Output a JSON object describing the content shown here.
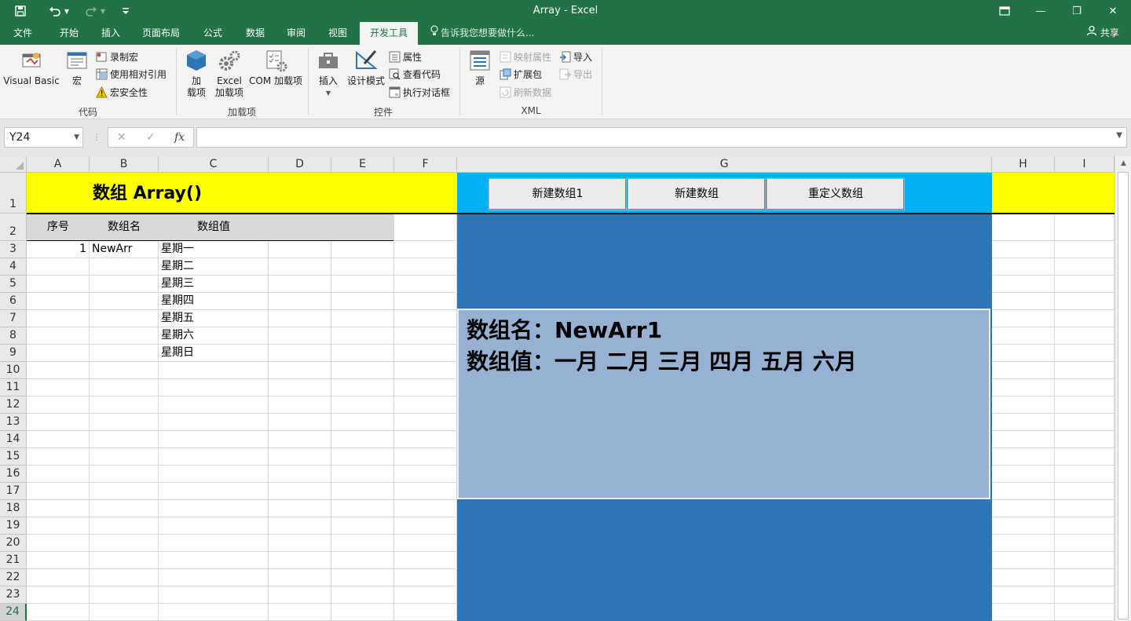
{
  "window": {
    "title": "Array - Excel",
    "save_icon": "save-icon",
    "undo_icon": "undo-icon",
    "redo_icon": "redo-icon",
    "customize_icon": "customize-quick-access-icon",
    "restore_ribbon_icon": "ribbon-display-options-icon",
    "minimize": "—",
    "maximize": "❐",
    "close": "✕"
  },
  "ribbon_tabs": [
    "文件",
    "开始",
    "插入",
    "页面布局",
    "公式",
    "数据",
    "审阅",
    "视图",
    "开发工具"
  ],
  "active_tab": "开发工具",
  "tell_me": "告诉我您想要做什么...",
  "share": "共享",
  "ribbon": {
    "code_group": {
      "label": "代码",
      "visual_basic": "Visual Basic",
      "macros": "宏",
      "record_macro": "录制宏",
      "relative_ref": "使用相对引用",
      "macro_security": "宏安全性"
    },
    "addins_group": {
      "label": "加载项",
      "addins_l1": "加",
      "addins_l2": "载项",
      "excel_addins_l1": "Excel",
      "excel_addins_l2": "加载项",
      "com_addins": "COM 加载项"
    },
    "controls_group": {
      "label": "控件",
      "insert": "插入",
      "design_mode": "设计模式",
      "properties": "属性",
      "view_code": "查看代码",
      "run_dialog": "执行对话框"
    },
    "xml_group": {
      "label": "XML",
      "source": "源",
      "map_properties": "映射属性",
      "expansion_packs": "扩展包",
      "refresh_data": "刷新数据",
      "import": "导入",
      "export": "导出"
    }
  },
  "formula_bar": {
    "name_box": "Y24",
    "cancel": "✕",
    "enter": "✓",
    "fx": "fx",
    "formula": ""
  },
  "columns": [
    "A",
    "B",
    "C",
    "D",
    "E",
    "F",
    "G",
    "H",
    "I"
  ],
  "rows": [
    "1",
    "2",
    "3",
    "4",
    "5",
    "6",
    "7",
    "8",
    "9",
    "10",
    "11",
    "12",
    "13",
    "14",
    "15",
    "16",
    "17",
    "18",
    "19",
    "20",
    "21",
    "22",
    "23",
    "24"
  ],
  "selected_row": "24",
  "sheet": {
    "title": "数组 Array()",
    "headers": {
      "index": "序号",
      "name": "数组名",
      "value": "数组值"
    },
    "index_value": "1",
    "array_name": "NewArr",
    "array_values": [
      "星期一",
      "星期二",
      "星期三",
      "星期四",
      "星期五",
      "星期六",
      "星期日"
    ]
  },
  "buttons": {
    "new_array1": "新建数组1",
    "new_array": "新建数组",
    "redefine_array": "重定义数组"
  },
  "output_box": {
    "line1": "数组名：NewArr1",
    "line2": "数组值：一月 二月 三月 四月 五月 六月"
  },
  "colors": {
    "excel_green": "#217346",
    "title_fill": "#ffff00",
    "button_bar": "#00b0f0",
    "panel_blue": "#2e75b6",
    "textbox_fill": "#97b1d2"
  }
}
